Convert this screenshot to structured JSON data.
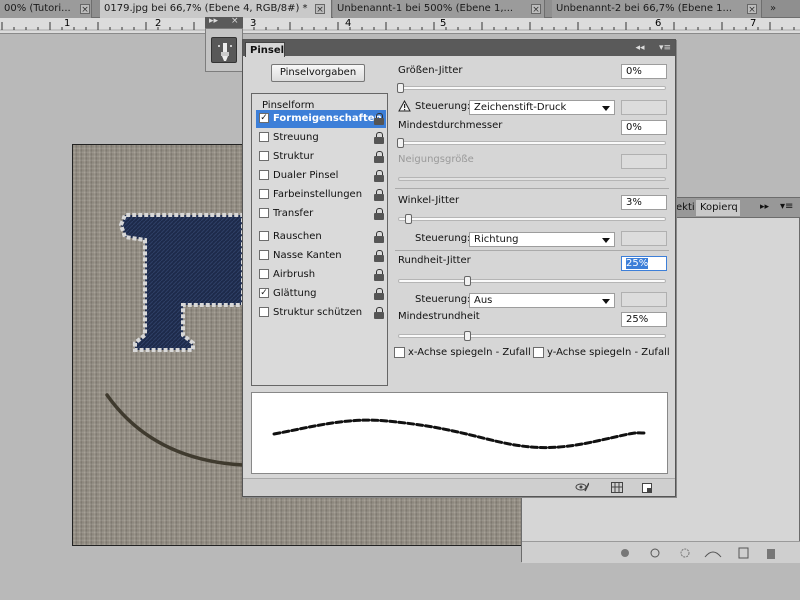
{
  "tabs": [
    {
      "label": "00% (Tutori..."
    },
    {
      "label": "0179.jpg bei 66,7% (Ebene 4, RGB/8#) *"
    },
    {
      "label": "Unbenannt-1 bei 500% (Ebene 1,..."
    },
    {
      "label": "Unbenannt-2 bei 66,7% (Ebene 1..."
    }
  ],
  "ruler": {
    "numbers": [
      "1",
      "2",
      "3",
      "4",
      "5",
      "6",
      "7"
    ]
  },
  "brush_panel": {
    "tab_label": "Pinsel",
    "presets_button": "Pinselvorgaben",
    "options_header": "Pinselform",
    "options": [
      {
        "label": "Formeigenschaften",
        "checked": true,
        "selected": true
      },
      {
        "label": "Streuung",
        "checked": false
      },
      {
        "label": "Struktur",
        "checked": false
      },
      {
        "label": "Dualer Pinsel",
        "checked": false
      },
      {
        "label": "Farbeinstellungen",
        "checked": false
      },
      {
        "label": "Transfer",
        "checked": false
      },
      {
        "label": "Rauschen",
        "checked": false
      },
      {
        "label": "Nasse Kanten",
        "checked": false
      },
      {
        "label": "Airbrush",
        "checked": false
      },
      {
        "label": "Glättung",
        "checked": true
      },
      {
        "label": "Struktur schützen",
        "checked": false
      }
    ],
    "size_jitter": {
      "label": "Größen-Jitter",
      "value": "0%",
      "level": 0.0
    },
    "control1": {
      "label": "Steuerung:",
      "value": "Zeichenstift-Druck"
    },
    "min_diameter": {
      "label": "Mindestdurchmesser",
      "value": "0%",
      "level": 0.0
    },
    "tilt_scale": {
      "label": "Neigungsgröße"
    },
    "angle_jitter": {
      "label": "Winkel-Jitter",
      "value": "3%",
      "level": 0.03
    },
    "control2": {
      "label": "Steuerung:",
      "value": "Richtung"
    },
    "roundness_jitter": {
      "label": "Rundheit-Jitter",
      "value": "25%",
      "level": 0.25
    },
    "control3": {
      "label": "Steuerung:",
      "value": "Aus"
    },
    "min_roundness": {
      "label": "Mindestrundheit",
      "value": "25%",
      "level": 0.25
    },
    "flip_x": {
      "label": "x-Achse spiegeln - Zufall",
      "checked": false
    },
    "flip_y": {
      "label": "y-Achse spiegeln - Zufall",
      "checked": false
    }
  },
  "panel2": {
    "tab1": "ekti",
    "tab2": "Kopierq"
  },
  "canvas": {
    "letter": "P"
  },
  "colors": {
    "selection": "#3d7fd8",
    "panel_bg": "#d6d6d6",
    "stitch_navy": "#1d2a4a"
  }
}
